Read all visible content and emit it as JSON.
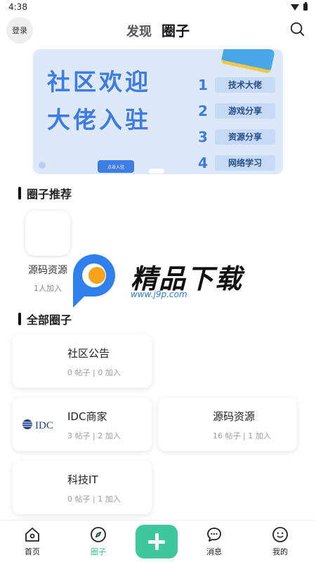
{
  "status_bar": {
    "time": "4:38"
  },
  "header": {
    "login_label": "登录",
    "tabs": [
      {
        "label": "发现",
        "active": false
      },
      {
        "label": "圈子",
        "active": true
      }
    ]
  },
  "banner": {
    "headline_line1": "社区欢迎",
    "headline_line2": "大佬入驻",
    "items": [
      {
        "number": "1",
        "label": "技术大佬"
      },
      {
        "number": "2",
        "label": "游戏分享"
      },
      {
        "number": "3",
        "label": "资源分享"
      },
      {
        "number": "4",
        "label": "网络学习"
      }
    ],
    "cta_label": "点击入驻"
  },
  "recommended": {
    "title": "圈子推荐",
    "items": [
      {
        "name": "源码资源",
        "joined": "1人加入"
      }
    ]
  },
  "all_circles": {
    "title": "全部圈子",
    "cards": [
      {
        "name": "社区公告",
        "meta": "0 帖子 | 0 加入",
        "logo": ""
      },
      {
        "name": "IDC商家",
        "meta": "3 帖子 | 2 加入",
        "logo": "IDC"
      },
      {
        "name": "源码资源",
        "meta": "16 帖子 | 1 加入",
        "logo": ""
      },
      {
        "name": "科技IT",
        "meta": "0 帖子 | 1 加入",
        "logo": ""
      }
    ]
  },
  "watermark": {
    "brand": "精品下载",
    "url": "www.j9p.com"
  },
  "bottom_nav": [
    {
      "label": "首页",
      "icon": "home-icon",
      "active": false
    },
    {
      "label": "圈子",
      "icon": "compass-icon",
      "active": true
    },
    {
      "label": "",
      "icon": "add-icon",
      "active": false
    },
    {
      "label": "消息",
      "icon": "chat-icon",
      "active": false
    },
    {
      "label": "我的",
      "icon": "face-icon",
      "active": false
    }
  ],
  "colors": {
    "accent_green": "#3ec79a",
    "banner_blue": "#3f7be0",
    "banner_bg": "#dde9f8"
  }
}
